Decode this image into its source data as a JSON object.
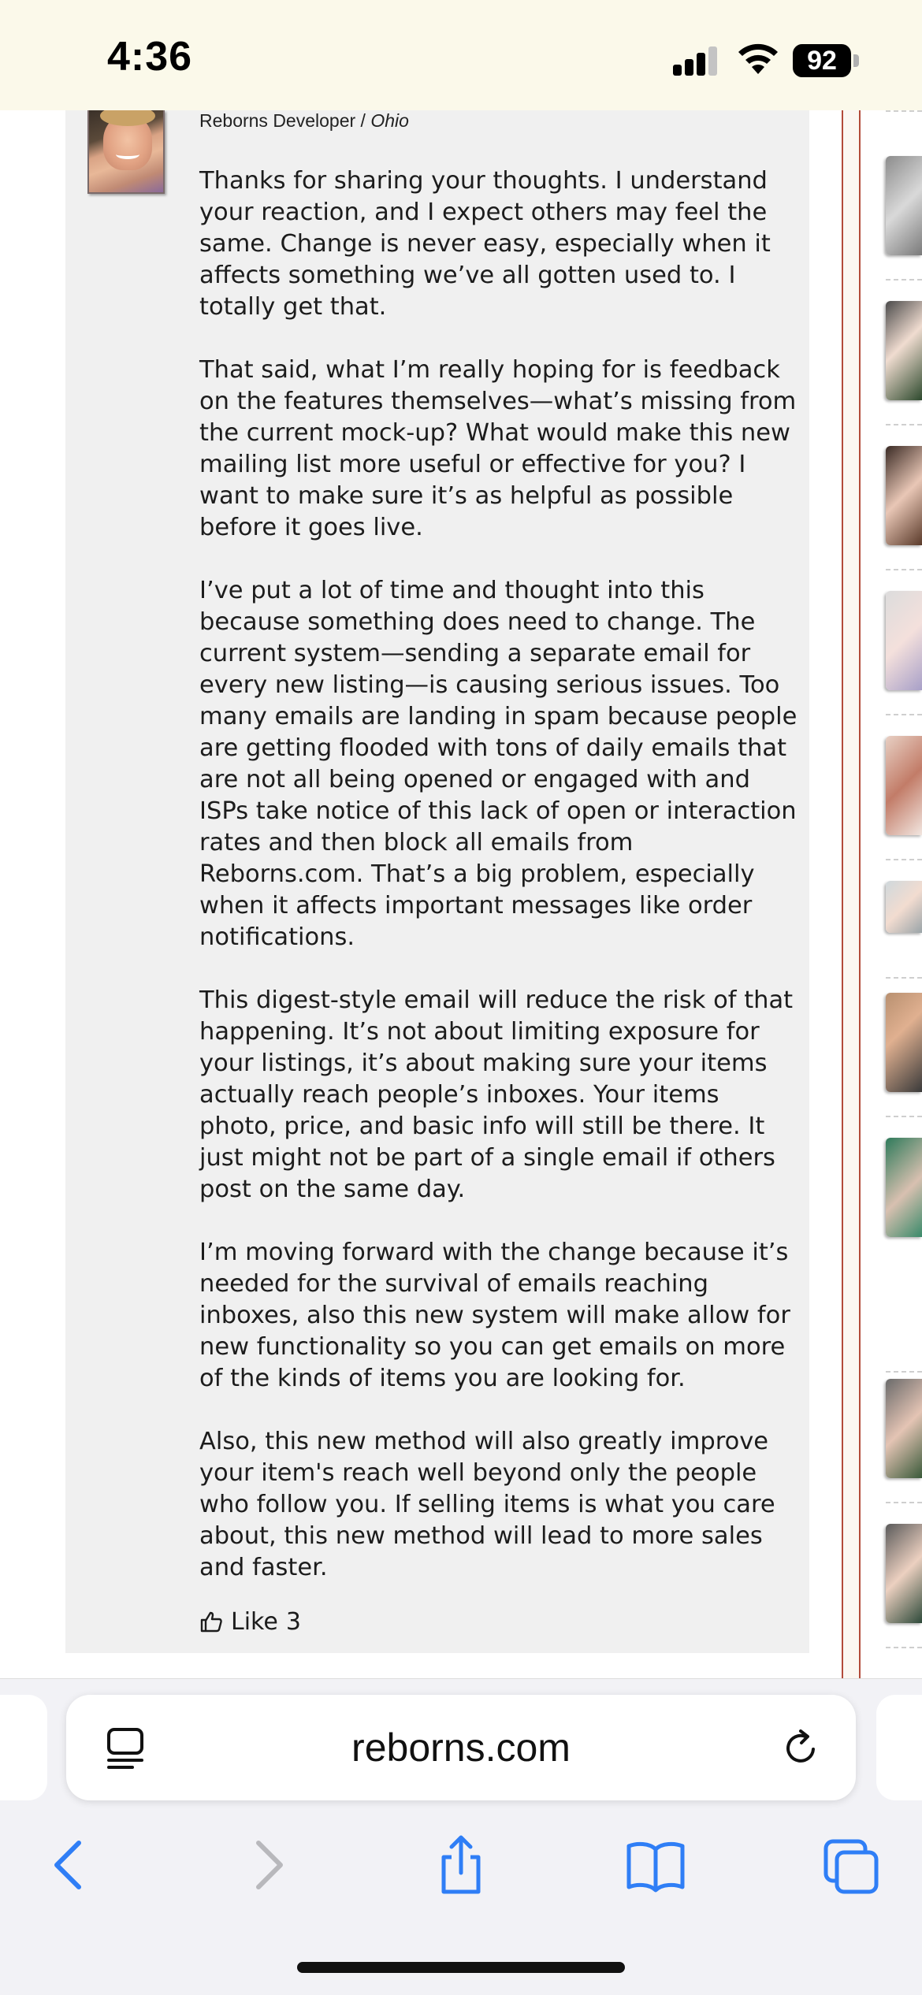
{
  "status_bar": {
    "time": "4:36",
    "battery": "92",
    "icons": [
      "signal-icon",
      "wifi-icon",
      "battery-icon"
    ]
  },
  "post": {
    "author_role": "Reborns Developer",
    "author_separator": " / ",
    "author_location": "Ohio",
    "paragraphs": [
      "Thanks for sharing your thoughts. I understand your reaction, and I expect others may feel the same. Change is never easy, especially when it affects something we’ve all gotten used to. I totally get that.",
      "That said, what I’m really hoping for is feedback on the features themselves—what’s missing from the current mock-up? What would make this new mailing list more useful or effective for you? I want to make sure it’s as helpful as possible before it goes live.",
      "I’ve put a lot of time and thought into this because something does need to change. The current system—sending a separate email for every new listing—is causing serious issues. Too many emails are landing in spam because people are getting flooded with tons of daily emails that are not all being opened or engaged with and ISPs take notice of this lack of open or interaction rates and then block all emails from Reborns.com. That’s a big problem, especially when it affects important messages like order notifications.",
      "This digest-style email will reduce the risk of that happening. It’s not about limiting exposure for your listings, it’s about making sure your items actually reach people’s inboxes. Your items photo, price, and basic info will still be there. It just might not be part of a single email if others post on the same day.",
      "I’m moving forward with the change because it’s needed for the survival of emails reaching inboxes, also this new system will make allow for new functionality so you can get emails on more of the kinds of items you are looking for.",
      "Also, this new method will also greatly improve your item's reach well beyond only the people who follow you. If selling items is what you care about, this new method will lead to more sales and faster."
    ],
    "like_label": "Like",
    "like_count": "3"
  },
  "browser": {
    "url": "reborns.com",
    "icons": [
      "reader-mode-icon",
      "reload-icon",
      "back-icon",
      "forward-icon",
      "share-icon",
      "bookmarks-icon",
      "tabs-icon"
    ],
    "accent_color": "#2f7ef6",
    "disabled_color": "#b8b8bc"
  },
  "colors": {
    "status_bar_bg": "#fbf9ea",
    "post_bg": "#f0f0f0",
    "frame_line": "#b24a3a"
  }
}
